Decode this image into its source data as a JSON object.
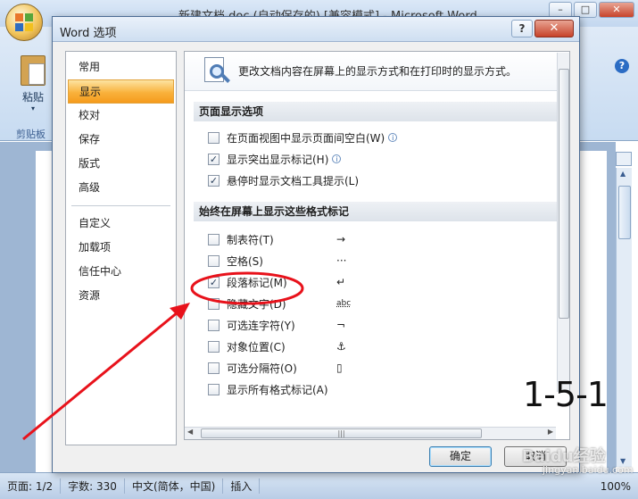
{
  "window": {
    "title": "新建文档.doc (自动保存的) [兼容模式] - Microsoft Word",
    "controls": [
      "–",
      "□",
      "✕"
    ]
  },
  "ribbon": {
    "paste_label": "粘贴",
    "paste_arrow": "▾",
    "clipboard_group": "剪贴板",
    "help": "?"
  },
  "statusbar": {
    "page": "页面: 1/2",
    "words": "字数: 330",
    "language": "中文(简体，中国)",
    "insert_mode": "插入",
    "zoom": "100%"
  },
  "dialog": {
    "title": "Word 选项",
    "help": "?",
    "close": "✕",
    "nav": {
      "group1": [
        "常用",
        "显示",
        "校对",
        "保存",
        "版式",
        "高级"
      ],
      "group2": [
        "自定义",
        "加载项",
        "信任中心",
        "资源"
      ],
      "selected": "显示"
    },
    "header_text": "更改文档内容在屏幕上的显示方式和在打印时的显示方式。",
    "section1": {
      "title": "页面显示选项",
      "options": [
        {
          "label": "在页面视图中显示页面间空白(W)",
          "checked": false,
          "info": true
        },
        {
          "label": "显示突出显示标记(H)",
          "checked": true,
          "info": true
        },
        {
          "label": "悬停时显示文档工具提示(L)",
          "checked": true,
          "info": false
        }
      ]
    },
    "section2": {
      "title": "始终在屏幕上显示这些格式标记",
      "options": [
        {
          "label": "制表符(T)",
          "checked": false,
          "symbol": "→"
        },
        {
          "label": "空格(S)",
          "checked": false,
          "symbol": "···"
        },
        {
          "label": "段落标记(M)",
          "checked": true,
          "symbol": "↵"
        },
        {
          "label": "隐藏文字(D)",
          "checked": false,
          "symbol": "abc"
        },
        {
          "label": "可选连字符(Y)",
          "checked": false,
          "symbol": "¬"
        },
        {
          "label": "对象位置(C)",
          "checked": false,
          "symbol": "⚓"
        },
        {
          "label": "可选分隔符(O)",
          "checked": false,
          "symbol": "▯"
        },
        {
          "label": "显示所有格式标记(A)",
          "checked": false,
          "symbol": ""
        }
      ]
    },
    "ok_label": "确定",
    "cancel_label": "取消",
    "check_glyph": "✓",
    "info_glyph": "i"
  },
  "annotation": {
    "step_label": "1-5-1",
    "highlight_color": "#e8121b",
    "watermark": "Baidu经验",
    "watermark_sub": "jingyan.baidu.com"
  }
}
